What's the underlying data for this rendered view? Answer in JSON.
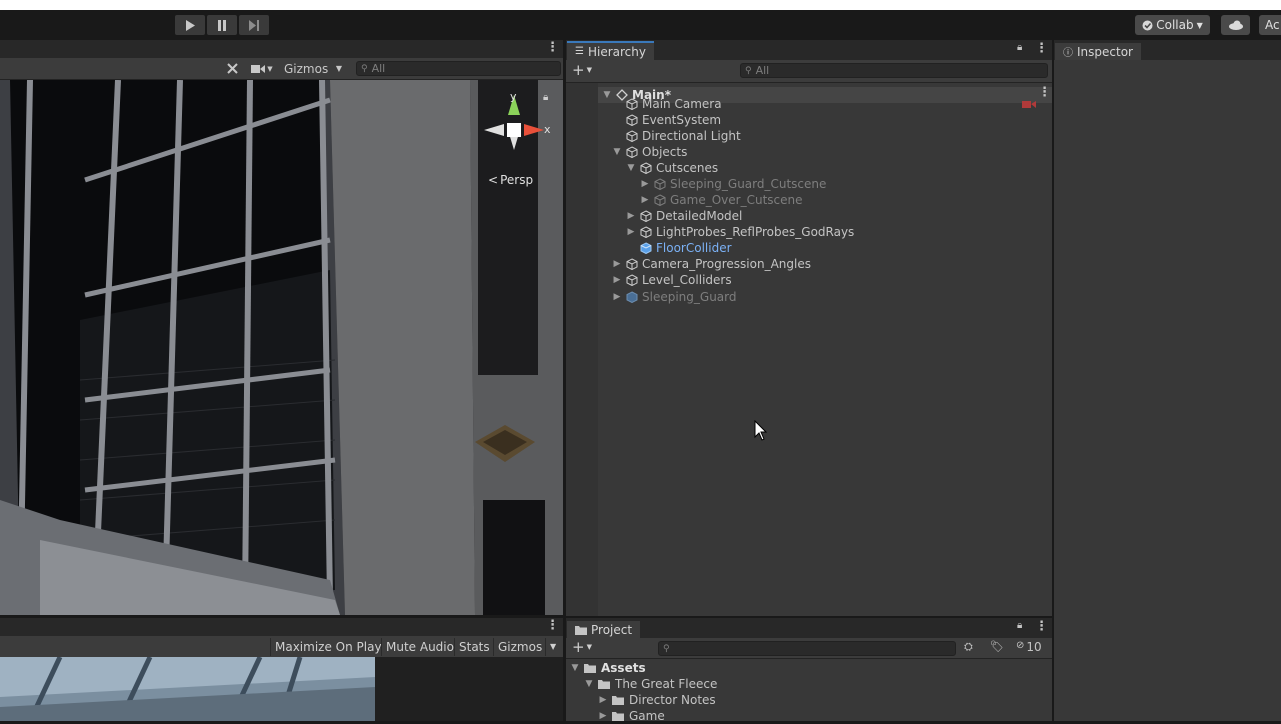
{
  "toolbar": {
    "collab_label": "Collab",
    "account_label": "Ac"
  },
  "scene": {
    "gizmos_label": "Gizmos",
    "search_placeholder": "All",
    "persp_label": "Persp",
    "axis_y": "y",
    "axis_x": "x"
  },
  "hierarchy": {
    "tab_label": "Hierarchy",
    "search_placeholder": "All",
    "scene_name": "Main*",
    "items": [
      {
        "label": "Main Camera"
      },
      {
        "label": "EventSystem"
      },
      {
        "label": "Directional Light"
      },
      {
        "label": "Objects"
      },
      {
        "label": "Cutscenes"
      },
      {
        "label": "Sleeping_Guard_Cutscene"
      },
      {
        "label": "Game_Over_Cutscene"
      },
      {
        "label": "DetailedModel"
      },
      {
        "label": "LightProbes_ReflProbes_GodRays"
      },
      {
        "label": "FloorCollider"
      },
      {
        "label": "Camera_Progression_Angles"
      },
      {
        "label": "Level_Colliders"
      },
      {
        "label": "Sleeping_Guard"
      }
    ]
  },
  "inspector": {
    "tab_label": "Inspector"
  },
  "game": {
    "maximize_label": "Maximize On Play",
    "mute_label": "Mute Audio",
    "stats_label": "Stats",
    "gizmos_label": "Gizmos"
  },
  "project": {
    "tab_label": "Project",
    "hidden_count": "10",
    "tree": [
      {
        "label": "Assets"
      },
      {
        "label": "The Great Fleece"
      },
      {
        "label": "Director Notes"
      },
      {
        "label": "Game"
      }
    ]
  },
  "colors": {
    "accent": "#3a79bb",
    "selected_text": "#7bb1f5",
    "disabled_text": "#7e7e7e"
  }
}
